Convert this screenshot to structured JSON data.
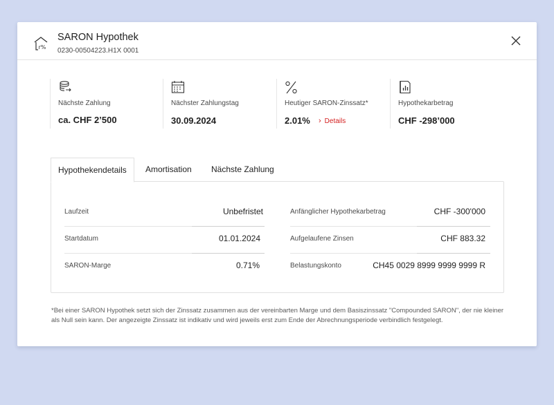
{
  "header": {
    "title": "SARON Hypothek",
    "account_number": "0230-00504223.H1X 0001",
    "icon": "house-percent-icon",
    "close_icon": "close-icon"
  },
  "stats": [
    {
      "icon": "coins-icon",
      "label": "Nächste Zahlung",
      "value": "ca. CHF 2’500"
    },
    {
      "icon": "calendar-icon",
      "label": "Nächster Zahlungstag",
      "value": "30.09.2024"
    },
    {
      "icon": "percent-icon",
      "label": "Heutiger SARON-Zinssatz*",
      "value": "2.01%",
      "link": "Details"
    },
    {
      "icon": "document-chart-icon",
      "label": "Hypothekarbetrag",
      "value": "CHF -298’000"
    }
  ],
  "tabs": [
    {
      "label": "Hypothekendetails",
      "active": true
    },
    {
      "label": "Amortisation",
      "active": false
    },
    {
      "label": "Nächste Zahlung",
      "active": false
    }
  ],
  "details": {
    "left": [
      {
        "label": "Laufzeit",
        "value": "Unbefristet"
      },
      {
        "label": "Startdatum",
        "value": "01.01.2024"
      },
      {
        "label": "SARON-Marge",
        "value": "0.71%"
      }
    ],
    "right": [
      {
        "label": "Anfänglicher Hypothekarbetrag",
        "value": "CHF -300'000"
      },
      {
        "label": "Aufgelaufene Zinsen",
        "value": "CHF 883.32"
      },
      {
        "label": "Belastungskonto",
        "value": "CH45 0029 8999 9999 9999 R"
      }
    ]
  },
  "footnote": "*Bei einer SARON Hypothek setzt sich der Zinssatz zusammen aus der vereinbarten Marge und dem Basiszinssatz \"Compounded SARON\", der nie kleiner als Null sein kann. Der angezeigte Zinssatz ist indikativ und wird jeweils erst zum Ende der Abrechnungsperiode verbindlich festgelegt.",
  "colors": {
    "background": "#d0d9f1",
    "accent_red": "#d42020",
    "text": "#1f1f1f"
  }
}
